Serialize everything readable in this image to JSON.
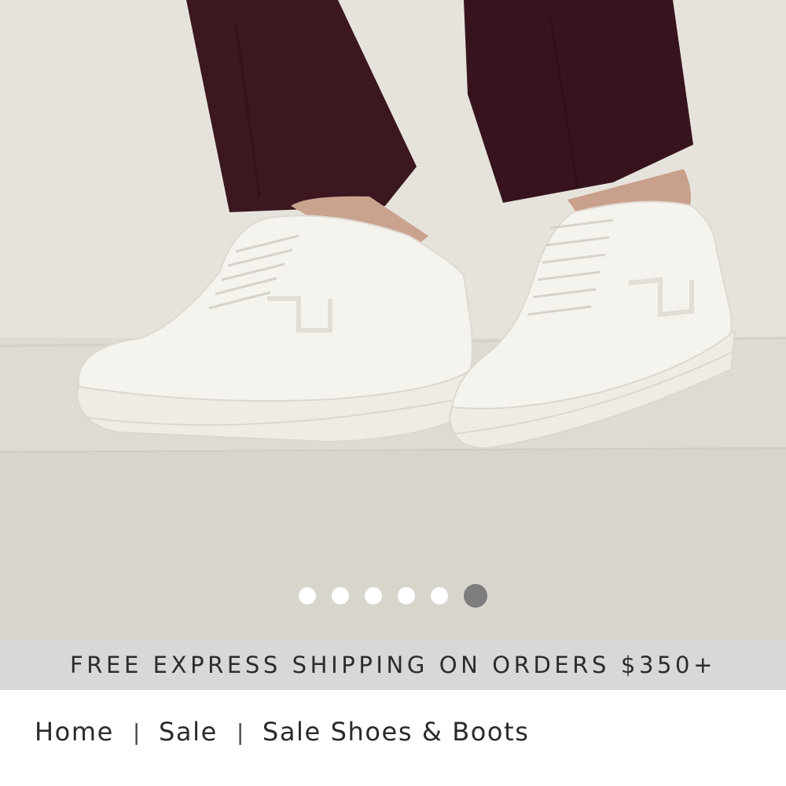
{
  "hero": {
    "image": "white-leather-sneakers-photo",
    "carousel": {
      "total_slides": 6,
      "active_slide": 6
    }
  },
  "promo": {
    "text": "FREE EXPRESS SHIPPING ON ORDERS $350+"
  },
  "breadcrumb": {
    "items": [
      {
        "label": "Home"
      },
      {
        "label": "Sale"
      },
      {
        "label": "Sale Shoes & Boots"
      }
    ],
    "separator": "|"
  },
  "colors": {
    "promo_bg": "#d9d8d6",
    "dot_inactive": "#ffffff",
    "dot_active": "#7d7d7d",
    "trousers": "#3a1620",
    "sneaker": "#f4f2ec"
  }
}
